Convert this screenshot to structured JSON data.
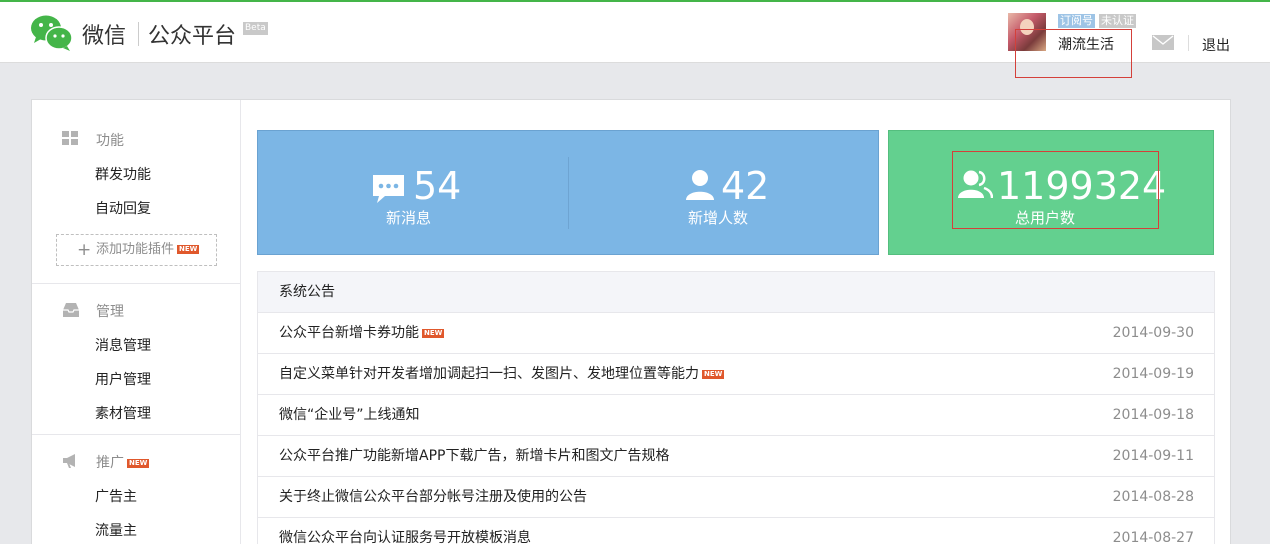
{
  "header": {
    "logo_wechat": "微信",
    "logo_platform": "公众平台",
    "beta": "Beta",
    "tag_type": "订阅号",
    "tag_status": "未认证",
    "account_name": "潮流生活",
    "logout": "退出"
  },
  "sidebar": {
    "sections": [
      {
        "title": "功能",
        "items": [
          "群发功能",
          "自动回复"
        ]
      },
      {
        "title": "管理",
        "items": [
          "消息管理",
          "用户管理",
          "素材管理"
        ]
      },
      {
        "title": "推广",
        "items": [
          "广告主",
          "流量主"
        ]
      }
    ],
    "add_plugin": "添加功能插件",
    "new_badge": "NEW"
  },
  "stats": {
    "new_messages": {
      "value": "54",
      "label": "新消息"
    },
    "new_users": {
      "value": "42",
      "label": "新增人数"
    },
    "total_users": {
      "value": "1199324",
      "label": "总用户数"
    }
  },
  "notice": {
    "title": "系统公告",
    "rows": [
      {
        "title": "公众平台新增卡券功能",
        "date": "2014-09-30",
        "is_new": true
      },
      {
        "title": "自定义菜单针对开发者增加调起扫一扫、发图片、发地理位置等能力",
        "date": "2014-09-19",
        "is_new": true
      },
      {
        "title": "微信“企业号”上线通知",
        "date": "2014-09-18",
        "is_new": false
      },
      {
        "title": "公众平台推广功能新增APP下载广告，新增卡片和图文广告规格",
        "date": "2014-09-11",
        "is_new": false
      },
      {
        "title": "关于终止微信公众平台部分帐号注册及使用的公告",
        "date": "2014-08-28",
        "is_new": false
      },
      {
        "title": "微信公众平台向认证服务号开放模板消息",
        "date": "2014-08-27",
        "is_new": false
      }
    ]
  },
  "colors": {
    "brand_green": "#44b549",
    "stat_blue": "#7cb6e5",
    "stat_green": "#63d08f",
    "new_badge": "#e0582c",
    "highlight_red": "#d4403a"
  },
  "icons": [
    "wechat-logo-icon",
    "mail-icon",
    "grid-icon",
    "inbox-icon",
    "megaphone-icon",
    "chat-bubble-icon",
    "user-icon",
    "users-icon"
  ]
}
